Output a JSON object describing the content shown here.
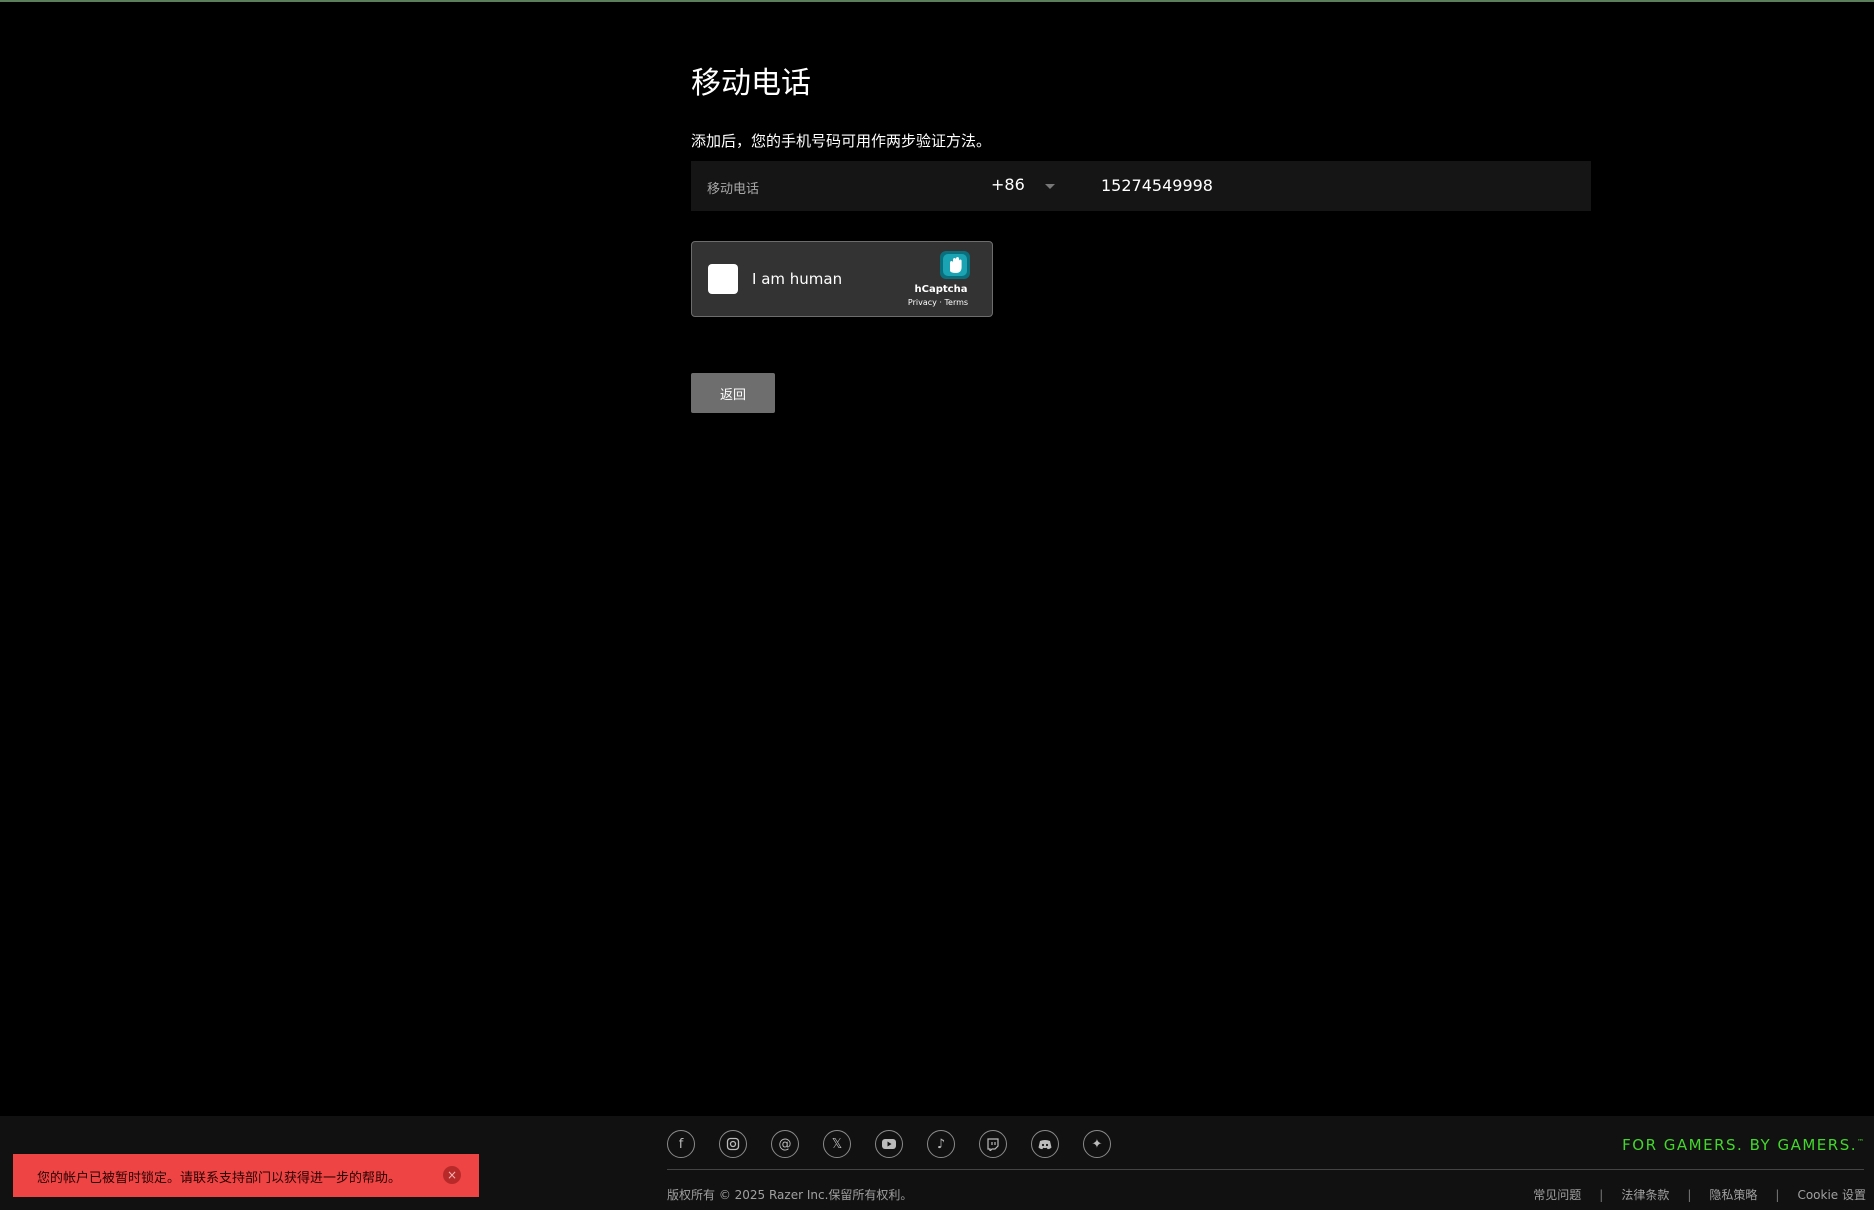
{
  "page": {
    "title": "移动电话",
    "description": "添加后，您的手机号码可用作两步验证方法。"
  },
  "phone": {
    "label": "移动电话",
    "country_code": "+86",
    "number": "15274549998"
  },
  "captcha": {
    "label": "I am human",
    "brand": "hCaptcha",
    "links": "Privacy · Terms"
  },
  "actions": {
    "back_label": "返回"
  },
  "footer": {
    "socials": [
      "facebook-icon",
      "instagram-icon",
      "threads-icon",
      "x-icon",
      "youtube-icon",
      "tiktok-icon",
      "twitch-icon",
      "discord-icon",
      "razer-icon"
    ],
    "tagline": "FOR GAMERS. BY GAMERS.",
    "tagline_mark": "™",
    "copyright": "版权所有 © 2025 Razer Inc.保留所有权利。",
    "links": [
      "常见问题",
      "法律条款",
      "隐私策略",
      "Cookie 设置"
    ],
    "separator": "|"
  },
  "toast": {
    "message": "您的帐户已被暂时锁定。请联系支持部门以获得进一步的帮助。",
    "close_symbol": "×"
  },
  "colors": {
    "accent": "#44d62c",
    "toast_bg": "#ee4444",
    "button_bg": "#6e6e6e"
  }
}
